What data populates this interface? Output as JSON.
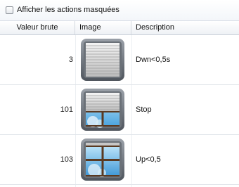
{
  "toolbar": {
    "show_hidden_label": "Afficher les actions masquées",
    "show_hidden_checked": false
  },
  "table": {
    "columns": [
      "Valeur brute",
      "Image",
      "Description"
    ],
    "rows": [
      {
        "value": "3",
        "image": "shutter-closed-icon",
        "description": "Dwn<0,5s"
      },
      {
        "value": "101",
        "image": "shutter-half-icon",
        "description": "Stop"
      },
      {
        "value": "103",
        "image": "shutter-open-icon",
        "description": "Up<0,5"
      }
    ]
  }
}
